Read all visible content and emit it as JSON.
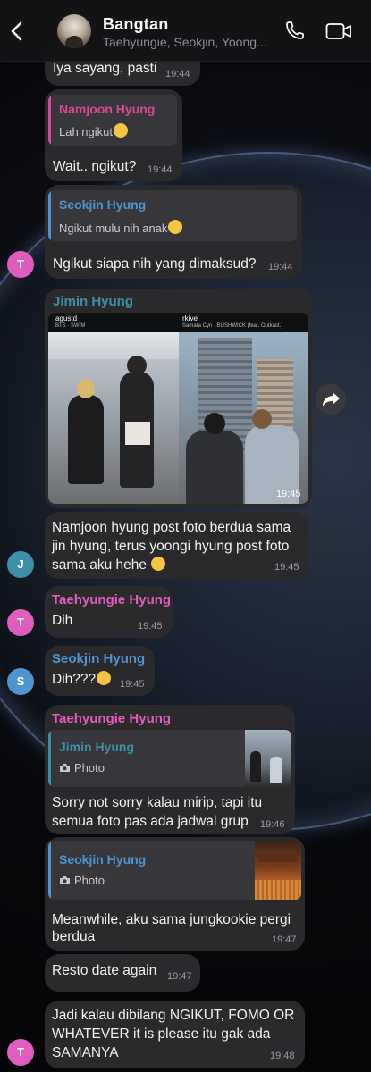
{
  "header": {
    "title": "Bangtan",
    "subtitle": "Taehyungie, Seokjin, Yoong..."
  },
  "messages": {
    "m1": {
      "text": "Iya sayang, pasti",
      "time": "19:44"
    },
    "m2": {
      "reply_name": "Namjoon Hyung",
      "reply_text": "Lah ngikut",
      "text": "Wait.. ngikut?",
      "time": "19:44"
    },
    "m3": {
      "reply_name": "Seokjin Hyung",
      "reply_text": "Ngikut mulu nih anak",
      "text": "Ngikut siapa nih yang dimaksud?",
      "time": "19:44",
      "avatar": "T"
    },
    "m4": {
      "sender": "Jimin Hyung",
      "time": "19:45",
      "post_left_user": "agustd",
      "post_left_track": "BTS · SWIM",
      "post_right_user": "rkive",
      "post_right_track": "Samara Cyn · BUSHWICK (feat. Outkast.)"
    },
    "m5": {
      "text_line1": "Namjoon hyung post foto berdua sama",
      "text_line2": "jin hyung, terus yoongi hyung post foto",
      "text_line3": "sama aku hehe",
      "time": "19:45",
      "avatar": "J"
    },
    "m6": {
      "sender": "Taehyungie Hyung",
      "text": "Dih",
      "time": "19:45",
      "avatar": "T"
    },
    "m7": {
      "sender": "Seokjin Hyung",
      "text": "Dih???",
      "time": "19:45",
      "avatar": "S"
    },
    "m8": {
      "sender": "Taehyungie Hyung",
      "reply_name": "Jimin Hyung",
      "reply_text": "Photo",
      "text_line1": "Sorry not sorry kalau mirip, tapi itu",
      "text_line2": "semua foto pas ada jadwal grup",
      "time": "19:46"
    },
    "m9": {
      "reply_name": "Seokjin Hyung",
      "reply_text": "Photo",
      "text_line1": "Meanwhile, aku sama jungkookie pergi",
      "text_line2": "berdua",
      "time": "19:47"
    },
    "m10": {
      "text": "Resto date again",
      "time": "19:47"
    },
    "m11": {
      "text_line1": "Jadi kalau dibilang NGIKUT, FOMO OR",
      "text_line2": "WHATEVER it is please itu gak ada",
      "text_line3": "SAMANYA",
      "time": "19:48",
      "avatar": "T"
    }
  },
  "colors": {
    "namjoon": "#d9489a",
    "seokjin": "#4f93d0",
    "jimin": "#3f8fa8",
    "taehyungie": "#e15cbf",
    "bubble": "#2a2a2d"
  },
  "icons": [
    "back-chevron-icon",
    "phone-icon",
    "video-camera-icon",
    "share-forward-icon",
    "camera-icon",
    "music-note-icon",
    "verified-icon"
  ]
}
